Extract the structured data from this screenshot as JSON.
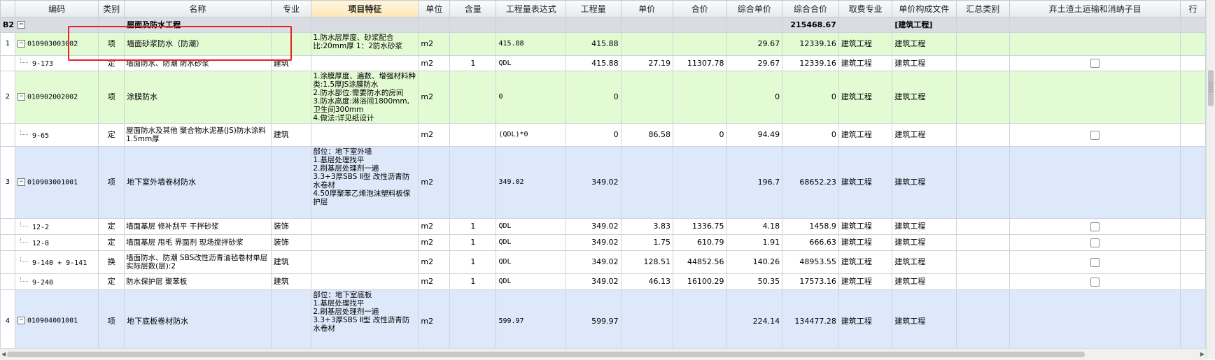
{
  "columns": [
    "编码",
    "类别",
    "名称",
    "专业",
    "项目特征",
    "单位",
    "含量",
    "工程量表达式",
    "工程量",
    "单价",
    "合价",
    "综合单价",
    "综合合价",
    "取费专业",
    "单价构成文件",
    "汇总类别",
    "弃土渣土运输和消纳子目",
    "行"
  ],
  "section": {
    "index": "B2",
    "toggle": "−",
    "name": "屋面及防水工程",
    "total": "215468.67",
    "file": "[建筑工程]"
  },
  "rows": [
    {
      "idx": "1",
      "type": "项",
      "code": "010903003002",
      "category": "项",
      "name": "墙面砂浆防水（防潮）",
      "spec": "",
      "feature": "1.防水层厚度、砂浆配合比:20mm厚 1：2防水砂浆",
      "unit": "m2",
      "qty_ratio": "",
      "expr": "415.88",
      "qty": "415.88",
      "price": "",
      "amount": "",
      "comp_price": "29.67",
      "comp_amount": "12339.16",
      "fee": "建筑工程",
      "file": "建筑工程",
      "color": "qg"
    },
    {
      "idx": "",
      "type": "定",
      "code": "9-173",
      "category": "定",
      "name": "墙面防水、防潮 防水砂浆",
      "spec": "建筑",
      "feature": "",
      "unit": "m2",
      "qty_ratio": "1",
      "expr": "QDL",
      "qty": "415.88",
      "price": "27.19",
      "amount": "11307.78",
      "comp_price": "29.67",
      "comp_amount": "12339.16",
      "fee": "建筑工程",
      "file": "建筑工程",
      "color": "qn"
    },
    {
      "idx": "2",
      "type": "项",
      "code": "010902002002",
      "category": "项",
      "name": "涂膜防水",
      "spec": "",
      "feature": "1.涂膜厚度、遍数、增强材料种类:1.5厚JS涂膜防水\n2.防水部位:需要防水的房间\n3.防水高度:淋浴间1800mm,卫生间300mm\n4.做法:详见纸设计",
      "unit": "m2",
      "qty_ratio": "",
      "expr": "0",
      "qty": "0",
      "price": "",
      "amount": "",
      "comp_price": "0",
      "comp_amount": "0",
      "fee": "建筑工程",
      "file": "建筑工程",
      "color": "qg"
    },
    {
      "idx": "",
      "type": "定",
      "code": "9-65",
      "category": "定",
      "name": "屋面防水及其他 聚合物水泥基(JS)防水涂料 1.5mm厚",
      "spec": "建筑",
      "feature": "",
      "unit": "m2",
      "qty_ratio": "",
      "expr": "(QDL)*0",
      "qty": "0",
      "price": "86.58",
      "amount": "0",
      "comp_price": "94.49",
      "comp_amount": "0",
      "fee": "建筑工程",
      "file": "建筑工程",
      "color": "qn"
    },
    {
      "idx": "3",
      "type": "项",
      "code": "010903001001",
      "category": "项",
      "name": "地下室外墙卷材防水",
      "spec": "",
      "feature": "部位：地下室外墙\n1.基层处理找平\n2.刷基层处理剂一遍\n3.3+3厚SBS Ⅱ型 改性沥青防水卷材\n4.50厚聚苯乙烯泡沫塑料板保护层",
      "unit": "m2",
      "qty_ratio": "",
      "expr": "349.02",
      "qty": "349.02",
      "price": "",
      "amount": "",
      "comp_price": "196.7",
      "comp_amount": "68652.23",
      "fee": "建筑工程",
      "file": "建筑工程",
      "color": "qb"
    },
    {
      "idx": "",
      "type": "定",
      "code": "12-2",
      "category": "定",
      "name": "墙面基层 修补刮平 干拌砂浆",
      "spec": "装饰",
      "feature": "",
      "unit": "m2",
      "qty_ratio": "1",
      "expr": "QDL",
      "qty": "349.02",
      "price": "3.83",
      "amount": "1336.75",
      "comp_price": "4.18",
      "comp_amount": "1458.9",
      "fee": "建筑工程",
      "file": "建筑工程",
      "color": "qn"
    },
    {
      "idx": "",
      "type": "定",
      "code": "12-8",
      "category": "定",
      "name": "墙面基层 甩毛 界面剂 现场搅拌砂浆",
      "spec": "装饰",
      "feature": "",
      "unit": "m2",
      "qty_ratio": "1",
      "expr": "QDL",
      "qty": "349.02",
      "price": "1.75",
      "amount": "610.79",
      "comp_price": "1.91",
      "comp_amount": "666.63",
      "fee": "建筑工程",
      "file": "建筑工程",
      "color": "qn"
    },
    {
      "idx": "",
      "type": "定",
      "code": "9-140 + 9-141",
      "category": "换",
      "name": "墙面防水、防潮 SBS改性沥青油毡卷材单层  实际层数(层):2",
      "spec": "建筑",
      "feature": "",
      "unit": "m2",
      "qty_ratio": "1",
      "expr": "QDL",
      "qty": "349.02",
      "price": "128.51",
      "amount": "44852.56",
      "comp_price": "140.26",
      "comp_amount": "48953.55",
      "fee": "建筑工程",
      "file": "建筑工程",
      "color": "qn"
    },
    {
      "idx": "",
      "type": "定",
      "code": "9-240",
      "category": "定",
      "name": "防水保护层 聚苯板",
      "spec": "建筑",
      "feature": "",
      "unit": "m2",
      "qty_ratio": "1",
      "expr": "QDL",
      "qty": "349.02",
      "price": "46.13",
      "amount": "16100.29",
      "comp_price": "50.35",
      "comp_amount": "17573.16",
      "fee": "建筑工程",
      "file": "建筑工程",
      "color": "qn"
    },
    {
      "idx": "4",
      "type": "项",
      "code": "010904001001",
      "category": "项",
      "name": "地下底板卷材防水",
      "spec": "",
      "feature": "部位：地下室底板\n1.基层处理找平\n2.刷基层处理剂一遍\n3.3+3厚SBS Ⅱ型 改性沥青防水卷材",
      "unit": "m2",
      "qty_ratio": "",
      "expr": "599.97",
      "qty": "599.97",
      "price": "",
      "amount": "",
      "comp_price": "224.14",
      "comp_amount": "134477.28",
      "fee": "建筑工程",
      "file": "建筑工程",
      "color": "qb"
    }
  ]
}
